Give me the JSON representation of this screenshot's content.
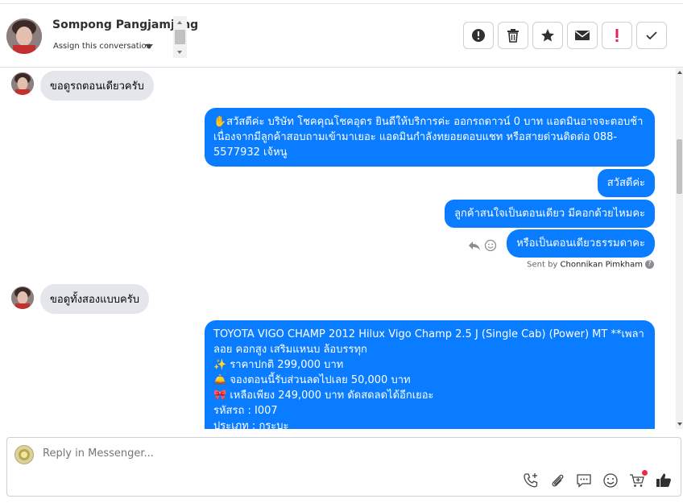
{
  "header": {
    "contact_name": "Sompong Pangjamjang",
    "assign_label": "Assign this conversation",
    "actions": [
      {
        "name": "alert-button",
        "icon": "exclamation-circle-icon"
      },
      {
        "name": "delete-button",
        "icon": "trash-icon"
      },
      {
        "name": "star-button",
        "icon": "star-icon"
      },
      {
        "name": "mark-unread-button",
        "icon": "envelope-icon"
      },
      {
        "name": "spam-button",
        "icon": "exclamation-icon"
      },
      {
        "name": "done-button",
        "icon": "checkmark-icon"
      }
    ]
  },
  "messages": {
    "m1": "ขอดูรถตอนเดียวครับ",
    "m2": "✋สวัสดีค่ะ บริษัท โชคคุณโชคอุดร ยินดีให้บริการค่ะ ออกรถดาวน์ 0 บาท แอดมินอาจจะตอบช้าเนื่องจากมีลูกค้าสอบถามเข้ามาเยอะ แอดมินกำลังทยอยตอบแชท หรือสายด่วนติดต่อ 088-5577932 เจ้หนู",
    "m3": "สวัสดีค่ะ",
    "m4": "ลูกค้าสนใจเป็นตอนเดียว มีคอกด้วยไหมคะ",
    "m5": "หรือเป็นตอนเดียวธรรมดาคะ",
    "sent_by_prefix": "Sent by",
    "sent_by_name": "Chonnikan Pimkham",
    "m6": "ขอดูทั้งสองแบบครับ",
    "m7_line1": "TOYOTA VIGO CHAMP 2012 Hilux Vigo Champ 2.5 J (Single Cab) (Power) MT **เพลาลอย คอกสูง เสริมแหนบ ล้อบรรทุก",
    "m7_line2": "✨ ราคาปกติ 299,000 บาท",
    "m7_line3": "🛎️ จองตอนนี้รับส่วนลดไปเลย 50,000 บาท",
    "m7_line4": "🎀 เหลือเพียง 249,000 บาท ดัดสดลดได้อีกเยอะ",
    "m7_line5": " รหัสรถ : I007",
    "m7_line6": " ประเภท : กระบะ"
  },
  "composer": {
    "placeholder": "Reply in Messenger...",
    "icons": [
      "phone-plus-icon",
      "paperclip-icon",
      "saved-reply-icon",
      "emoji-icon",
      "cart-icon",
      "thumbs-up-icon"
    ]
  },
  "colors": {
    "outgoing_bubble": "#0a7cff",
    "incoming_bubble": "#e4e6eb",
    "spam_red": "#e0245e"
  }
}
